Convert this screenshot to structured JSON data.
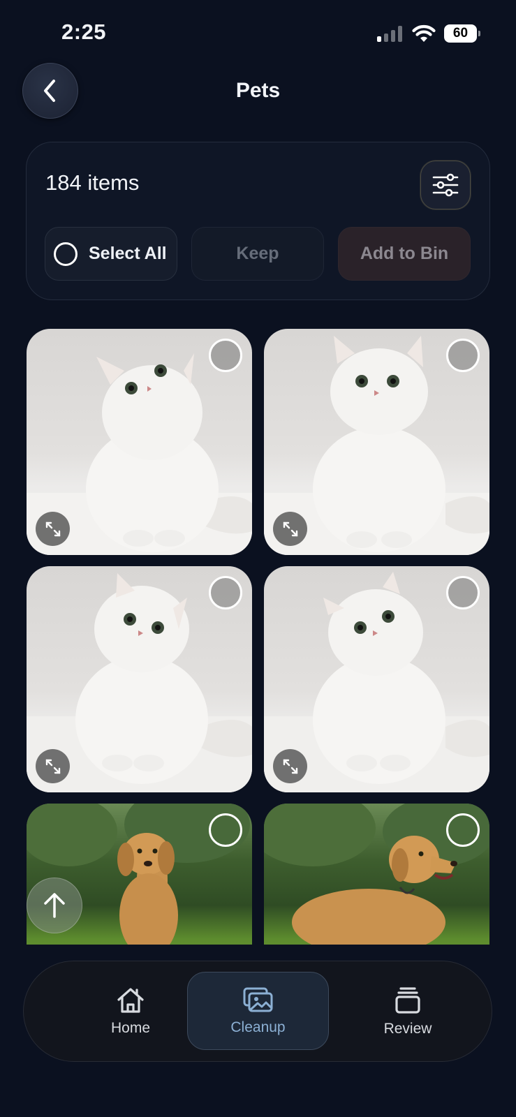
{
  "status_bar": {
    "time": "2:25",
    "battery": "60"
  },
  "header": {
    "title": "Pets",
    "back_icon": "chevron-left-icon"
  },
  "panel": {
    "count_label": "184 items",
    "filter_icon": "sliders-icon",
    "select_all_label": "Select All",
    "keep_label": "Keep",
    "add_to_bin_label": "Add to Bin"
  },
  "grid": {
    "tiles": [
      {
        "subject": "white persian cat",
        "selected": false
      },
      {
        "subject": "white persian cat",
        "selected": false
      },
      {
        "subject": "white persian cat",
        "selected": false
      },
      {
        "subject": "white persian cat",
        "selected": false
      },
      {
        "subject": "golden retriever",
        "selected": false
      },
      {
        "subject": "golden retriever",
        "selected": false
      }
    ]
  },
  "nav": {
    "home_label": "Home",
    "cleanup_label": "Cleanup",
    "review_label": "Review",
    "active": "Cleanup"
  },
  "colors": {
    "background": "#0b1120",
    "active_nav": "#8cb0d4",
    "bin_button": "#2a2229"
  }
}
